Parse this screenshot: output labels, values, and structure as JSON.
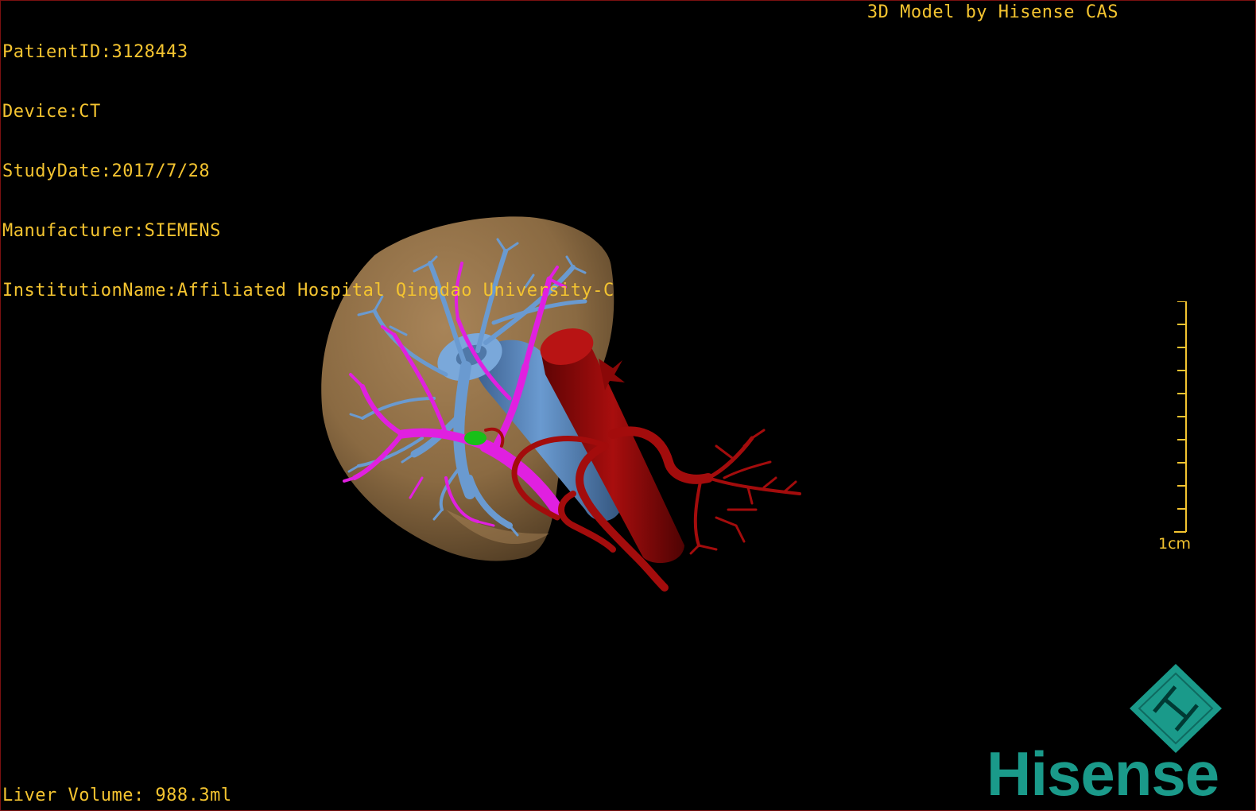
{
  "study_info": {
    "patient_id": "PatientID:3128443",
    "device": "Device:CT",
    "study_date": "StudyDate:2017/7/28",
    "manufacturer": "Manufacturer:SIEMENS",
    "institution": "InstitutionName:Affiliated Hospital Qingdao University-C"
  },
  "brand_caption": "3D Model by Hisense CAS",
  "scale": {
    "label": "1cm",
    "tick_count": 10
  },
  "liver_volume": "Liver Volume: 988.3ml",
  "logo": {
    "word": "Hisense",
    "mark_glyph": "H",
    "color": "#1a9a8a"
  },
  "model": {
    "structures": [
      "liver",
      "portal-vein",
      "hepatic-vein",
      "inferior-vena-cava",
      "aorta",
      "hepatic-artery",
      "gallbladder"
    ],
    "colors": {
      "liver": "#8a6a42",
      "portal_vein": "#e020e0",
      "hepatic_vein": "#6a9ad0",
      "vena_cava": "#5a88c4",
      "aorta": "#9a0a0a",
      "artery": "#a30c0c",
      "gallbladder": "#18c018"
    }
  }
}
